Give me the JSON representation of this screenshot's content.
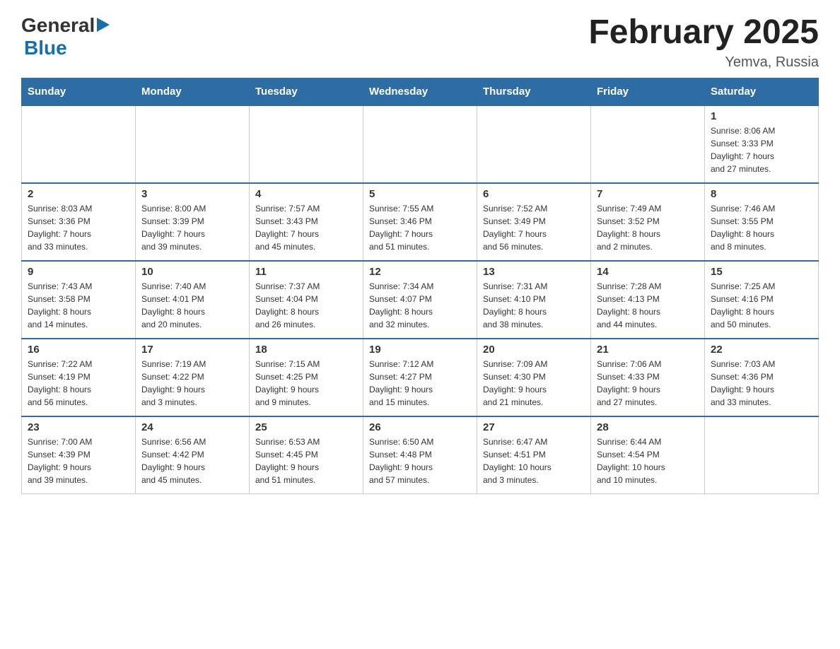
{
  "header": {
    "logo_general": "General",
    "logo_arrow": "▶",
    "logo_blue": "Blue",
    "month_title": "February 2025",
    "location": "Yemva, Russia"
  },
  "days_of_week": [
    "Sunday",
    "Monday",
    "Tuesday",
    "Wednesday",
    "Thursday",
    "Friday",
    "Saturday"
  ],
  "weeks": [
    {
      "days": [
        {
          "number": "",
          "info": "",
          "empty": true
        },
        {
          "number": "",
          "info": "",
          "empty": true
        },
        {
          "number": "",
          "info": "",
          "empty": true
        },
        {
          "number": "",
          "info": "",
          "empty": true
        },
        {
          "number": "",
          "info": "",
          "empty": true
        },
        {
          "number": "",
          "info": "",
          "empty": true
        },
        {
          "number": "1",
          "info": "Sunrise: 8:06 AM\nSunset: 3:33 PM\nDaylight: 7 hours\nand 27 minutes.",
          "empty": false
        }
      ]
    },
    {
      "days": [
        {
          "number": "2",
          "info": "Sunrise: 8:03 AM\nSunset: 3:36 PM\nDaylight: 7 hours\nand 33 minutes.",
          "empty": false
        },
        {
          "number": "3",
          "info": "Sunrise: 8:00 AM\nSunset: 3:39 PM\nDaylight: 7 hours\nand 39 minutes.",
          "empty": false
        },
        {
          "number": "4",
          "info": "Sunrise: 7:57 AM\nSunset: 3:43 PM\nDaylight: 7 hours\nand 45 minutes.",
          "empty": false
        },
        {
          "number": "5",
          "info": "Sunrise: 7:55 AM\nSunset: 3:46 PM\nDaylight: 7 hours\nand 51 minutes.",
          "empty": false
        },
        {
          "number": "6",
          "info": "Sunrise: 7:52 AM\nSunset: 3:49 PM\nDaylight: 7 hours\nand 56 minutes.",
          "empty": false
        },
        {
          "number": "7",
          "info": "Sunrise: 7:49 AM\nSunset: 3:52 PM\nDaylight: 8 hours\nand 2 minutes.",
          "empty": false
        },
        {
          "number": "8",
          "info": "Sunrise: 7:46 AM\nSunset: 3:55 PM\nDaylight: 8 hours\nand 8 minutes.",
          "empty": false
        }
      ]
    },
    {
      "days": [
        {
          "number": "9",
          "info": "Sunrise: 7:43 AM\nSunset: 3:58 PM\nDaylight: 8 hours\nand 14 minutes.",
          "empty": false
        },
        {
          "number": "10",
          "info": "Sunrise: 7:40 AM\nSunset: 4:01 PM\nDaylight: 8 hours\nand 20 minutes.",
          "empty": false
        },
        {
          "number": "11",
          "info": "Sunrise: 7:37 AM\nSunset: 4:04 PM\nDaylight: 8 hours\nand 26 minutes.",
          "empty": false
        },
        {
          "number": "12",
          "info": "Sunrise: 7:34 AM\nSunset: 4:07 PM\nDaylight: 8 hours\nand 32 minutes.",
          "empty": false
        },
        {
          "number": "13",
          "info": "Sunrise: 7:31 AM\nSunset: 4:10 PM\nDaylight: 8 hours\nand 38 minutes.",
          "empty": false
        },
        {
          "number": "14",
          "info": "Sunrise: 7:28 AM\nSunset: 4:13 PM\nDaylight: 8 hours\nand 44 minutes.",
          "empty": false
        },
        {
          "number": "15",
          "info": "Sunrise: 7:25 AM\nSunset: 4:16 PM\nDaylight: 8 hours\nand 50 minutes.",
          "empty": false
        }
      ]
    },
    {
      "days": [
        {
          "number": "16",
          "info": "Sunrise: 7:22 AM\nSunset: 4:19 PM\nDaylight: 8 hours\nand 56 minutes.",
          "empty": false
        },
        {
          "number": "17",
          "info": "Sunrise: 7:19 AM\nSunset: 4:22 PM\nDaylight: 9 hours\nand 3 minutes.",
          "empty": false
        },
        {
          "number": "18",
          "info": "Sunrise: 7:15 AM\nSunset: 4:25 PM\nDaylight: 9 hours\nand 9 minutes.",
          "empty": false
        },
        {
          "number": "19",
          "info": "Sunrise: 7:12 AM\nSunset: 4:27 PM\nDaylight: 9 hours\nand 15 minutes.",
          "empty": false
        },
        {
          "number": "20",
          "info": "Sunrise: 7:09 AM\nSunset: 4:30 PM\nDaylight: 9 hours\nand 21 minutes.",
          "empty": false
        },
        {
          "number": "21",
          "info": "Sunrise: 7:06 AM\nSunset: 4:33 PM\nDaylight: 9 hours\nand 27 minutes.",
          "empty": false
        },
        {
          "number": "22",
          "info": "Sunrise: 7:03 AM\nSunset: 4:36 PM\nDaylight: 9 hours\nand 33 minutes.",
          "empty": false
        }
      ]
    },
    {
      "days": [
        {
          "number": "23",
          "info": "Sunrise: 7:00 AM\nSunset: 4:39 PM\nDaylight: 9 hours\nand 39 minutes.",
          "empty": false
        },
        {
          "number": "24",
          "info": "Sunrise: 6:56 AM\nSunset: 4:42 PM\nDaylight: 9 hours\nand 45 minutes.",
          "empty": false
        },
        {
          "number": "25",
          "info": "Sunrise: 6:53 AM\nSunset: 4:45 PM\nDaylight: 9 hours\nand 51 minutes.",
          "empty": false
        },
        {
          "number": "26",
          "info": "Sunrise: 6:50 AM\nSunset: 4:48 PM\nDaylight: 9 hours\nand 57 minutes.",
          "empty": false
        },
        {
          "number": "27",
          "info": "Sunrise: 6:47 AM\nSunset: 4:51 PM\nDaylight: 10 hours\nand 3 minutes.",
          "empty": false
        },
        {
          "number": "28",
          "info": "Sunrise: 6:44 AM\nSunset: 4:54 PM\nDaylight: 10 hours\nand 10 minutes.",
          "empty": false
        },
        {
          "number": "",
          "info": "",
          "empty": true
        }
      ]
    }
  ]
}
